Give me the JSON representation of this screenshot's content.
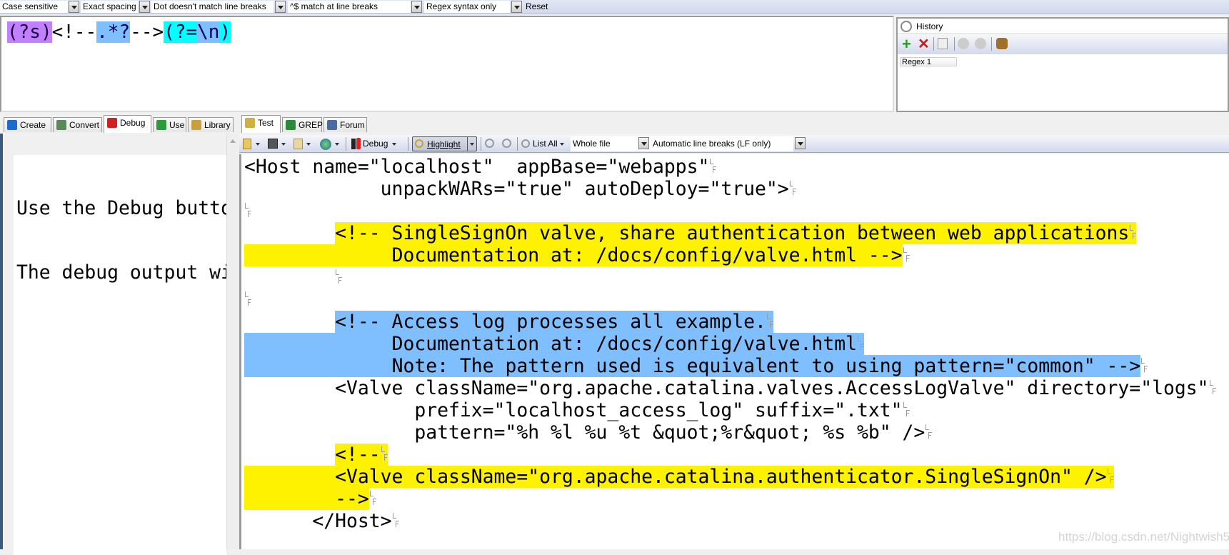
{
  "options_bar": {
    "case": "Case sensitive",
    "spacing": "Exact spacing",
    "dot": "Dot doesn't match line breaks",
    "anchors": "^$ match at line breaks",
    "syntax": "Regex syntax only",
    "reset": "Reset"
  },
  "regex": {
    "tokens": [
      {
        "t": "(?s)",
        "c": "purple"
      },
      {
        "t": "<!--",
        "c": null
      },
      {
        "t": ".*?",
        "c": "blue"
      },
      {
        "t": "-->",
        "c": null
      },
      {
        "t": "(?=",
        "c": "cyan"
      },
      {
        "t": "\\n",
        "c": "blue"
      },
      {
        "t": ")",
        "c": "cyan"
      }
    ]
  },
  "history": {
    "title": "History",
    "items": [
      "Regex 1"
    ]
  },
  "left_tabs": [
    {
      "label": "Create",
      "icon": "create-icon",
      "color": "#1e6bd0"
    },
    {
      "label": "Convert",
      "icon": "convert-icon",
      "color": "#5a8a5a"
    },
    {
      "label": "Debug",
      "icon": "debug-icon",
      "color": "#d02020",
      "selected": true
    },
    {
      "label": "Use",
      "icon": "use-icon",
      "color": "#2a9a3a"
    },
    {
      "label": "Library",
      "icon": "library-icon",
      "color": "#c8a040"
    }
  ],
  "debug_panel": {
    "lines": [
      "Use the Debug button to test the regex.",
      "The debug output will appear here."
    ]
  },
  "right_tabs": [
    {
      "label": "Test",
      "icon": "magnifier-icon",
      "color": "#d0b040",
      "selected": true
    },
    {
      "label": "GREP",
      "icon": "grep-icon",
      "color": "#2a8a3a"
    },
    {
      "label": "Forum",
      "icon": "forum-icon",
      "color": "#4a6aa0"
    }
  ],
  "test_toolbar": {
    "debug": "Debug",
    "highlight": "Highlight",
    "list_all": "List All",
    "scope": "Whole file",
    "line_breaks": "Automatic line breaks (LF only)"
  },
  "highlight_colors": {
    "yellow": "#fff200",
    "blue": "#80bfff"
  },
  "subject_lines": [
    {
      "pre": "",
      "text": "<Host name=\"localhost\"  appBase=\"webapps\"",
      "hl": null
    },
    {
      "pre": "            ",
      "text": "unpackWARs=\"true\" autoDeploy=\"true\">",
      "hl": null
    },
    {
      "pre": "",
      "text": "",
      "hl": null
    },
    {
      "pre": "        ",
      "text": "<!-- SingleSignOn valve, share authentication between web applications",
      "hl": "yellow",
      "hl_eol": true
    },
    {
      "pre": "             ",
      "text": "Documentation at: /docs/config/valve.html -->",
      "hl": "yellow",
      "hl_pre": true
    },
    {
      "pre": "        ",
      "text": "",
      "hl": null
    },
    {
      "pre": "",
      "text": "",
      "hl": null
    },
    {
      "pre": "        ",
      "text": "<!-- Access log processes all example.",
      "hl": "blue",
      "hl_eol": true
    },
    {
      "pre": "             ",
      "text": "Documentation at: /docs/config/valve.html",
      "hl": "blue",
      "hl_pre": true,
      "hl_eol": true
    },
    {
      "pre": "             ",
      "text": "Note: The pattern used is equivalent to using pattern=\"common\" -->",
      "hl": "blue",
      "hl_pre": true
    },
    {
      "pre": "        ",
      "text": "<Valve className=\"org.apache.catalina.valves.AccessLogValve\" directory=\"logs\"",
      "hl": null
    },
    {
      "pre": "               ",
      "text": "prefix=\"localhost_access_log\" suffix=\".txt\"",
      "hl": null
    },
    {
      "pre": "               ",
      "text": "pattern=\"%h %l %u %t &quot;%r&quot; %s %b\" />",
      "hl": null
    },
    {
      "pre": "        ",
      "text": "<!--",
      "hl": "yellow",
      "hl_eol": true
    },
    {
      "pre": "        ",
      "text": "<Valve className=\"org.apache.catalina.authenticator.SingleSignOn\" />",
      "hl": "yellow",
      "hl_pre": true,
      "hl_eol": true
    },
    {
      "pre": "        ",
      "text": "-->",
      "hl": "yellow",
      "hl_pre": true
    },
    {
      "pre": "      ",
      "text": "</Host>",
      "hl": null
    }
  ],
  "watermark": "https://blog.csdn.net/Nightwish5"
}
